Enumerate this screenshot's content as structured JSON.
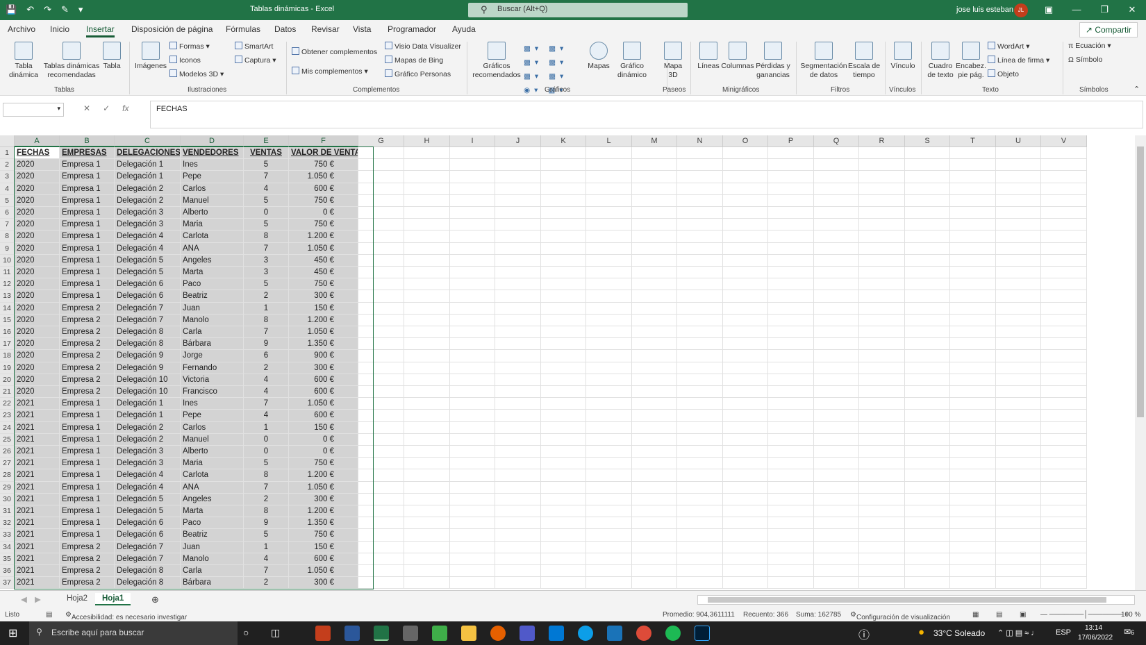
{
  "titlebar": {
    "title": "Tablas dinámicas  -  Excel",
    "search_placeholder": "Buscar (Alt+Q)",
    "user": "jose luis esteban",
    "avatar": "JL"
  },
  "tabs": [
    "Archivo",
    "Inicio",
    "Insertar",
    "Disposición de página",
    "Fórmulas",
    "Datos",
    "Revisar",
    "Vista",
    "Programador",
    "Ayuda"
  ],
  "active_tab": "Insertar",
  "share_label": "Compartir",
  "ribbon": {
    "tablas": {
      "b1": "Tabla dinámica",
      "b2": "Tablas dinámicas recomendadas",
      "b3": "Tabla",
      "label": "Tablas"
    },
    "ilustr": {
      "imagenes": "Imágenes",
      "formas": "Formas",
      "iconos": "Iconos",
      "modelos": "Modelos 3D",
      "smartart": "SmartArt",
      "captura": "Captura",
      "label": "Ilustraciones"
    },
    "compl": {
      "obtener": "Obtener complementos",
      "mis": "Mis complementos",
      "visio": "Visio Data Visualizer",
      "bing": "Mapas de Bing",
      "personas": "Gráfico Personas",
      "label": "Complementos"
    },
    "graf": {
      "recom": "Gráficos recomendados",
      "mapas": "Mapas",
      "dinamico": "Gráfico dinámico",
      "label": "Gráficos"
    },
    "paseos": {
      "mapa": "Mapa 3D",
      "label": "Paseos"
    },
    "mini": {
      "lineas": "Líneas",
      "columnas": "Columnas",
      "perdidas": "Pérdidas y ganancias",
      "label": "Minigráficos"
    },
    "filtros": {
      "seg": "Segmentación de datos",
      "escala": "Escala de tiempo",
      "label": "Filtros"
    },
    "vinc": {
      "vinculo": "Vínculo",
      "label": "Vínculos"
    },
    "texto": {
      "cuadro": "Cuadro de texto",
      "encab": "Encabez. pie pág.",
      "wordart": "WordArt",
      "firma": "Línea de firma",
      "objeto": "Objeto",
      "label": "Texto"
    },
    "simb": {
      "ecuacion": "Ecuación",
      "simbolo": "Símbolo",
      "label": "Símbolos"
    }
  },
  "formula_bar": {
    "value": "FECHAS",
    "fx": "fx"
  },
  "columns": [
    "A",
    "B",
    "C",
    "D",
    "E",
    "F",
    "G",
    "H",
    "I",
    "J",
    "K",
    "L",
    "M",
    "N",
    "O",
    "P",
    "Q",
    "R",
    "S",
    "T",
    "U",
    "V"
  ],
  "headers": [
    "FECHAS",
    "EMPRESAS",
    "DELEGACIONES",
    "VENDEDORES",
    "VENTAS",
    "VALOR DE VENTAS"
  ],
  "rows": [
    [
      "2020",
      "Empresa 1",
      "Delegación 1",
      "Ines",
      "5",
      "750 €"
    ],
    [
      "2020",
      "Empresa 1",
      "Delegación 1",
      "Pepe",
      "7",
      "1.050 €"
    ],
    [
      "2020",
      "Empresa 1",
      "Delegación 2",
      "Carlos",
      "4",
      "600 €"
    ],
    [
      "2020",
      "Empresa 1",
      "Delegación 2",
      "Manuel",
      "5",
      "750 €"
    ],
    [
      "2020",
      "Empresa 1",
      "Delegación 3",
      "Alberto",
      "0",
      "0 €"
    ],
    [
      "2020",
      "Empresa 1",
      "Delegación 3",
      "Maria",
      "5",
      "750 €"
    ],
    [
      "2020",
      "Empresa 1",
      "Delegación 4",
      "Carlota",
      "8",
      "1.200 €"
    ],
    [
      "2020",
      "Empresa 1",
      "Delegación 4",
      "ANA",
      "7",
      "1.050 €"
    ],
    [
      "2020",
      "Empresa 1",
      "Delegación 5",
      "Angeles",
      "3",
      "450 €"
    ],
    [
      "2020",
      "Empresa 1",
      "Delegación 5",
      "Marta",
      "3",
      "450 €"
    ],
    [
      "2020",
      "Empresa 1",
      "Delegación 6",
      "Paco",
      "5",
      "750 €"
    ],
    [
      "2020",
      "Empresa 1",
      "Delegación 6",
      "Beatriz",
      "2",
      "300 €"
    ],
    [
      "2020",
      "Empresa 2",
      "Delegación 7",
      "Juan",
      "1",
      "150 €"
    ],
    [
      "2020",
      "Empresa 2",
      "Delegación 7",
      "Manolo",
      "8",
      "1.200 €"
    ],
    [
      "2020",
      "Empresa 2",
      "Delegación 8",
      "Carla",
      "7",
      "1.050 €"
    ],
    [
      "2020",
      "Empresa 2",
      "Delegación 8",
      "Bárbara",
      "9",
      "1.350 €"
    ],
    [
      "2020",
      "Empresa 2",
      "Delegación 9",
      "Jorge",
      "6",
      "900 €"
    ],
    [
      "2020",
      "Empresa 2",
      "Delegación 9",
      "Fernando",
      "2",
      "300 €"
    ],
    [
      "2020",
      "Empresa 2",
      "Delegación 10",
      "Victoria",
      "4",
      "600 €"
    ],
    [
      "2020",
      "Empresa 2",
      "Delegación 10",
      "Francisco",
      "4",
      "600 €"
    ],
    [
      "2021",
      "Empresa 1",
      "Delegación 1",
      "Ines",
      "7",
      "1.050 €"
    ],
    [
      "2021",
      "Empresa 1",
      "Delegación 1",
      "Pepe",
      "4",
      "600 €"
    ],
    [
      "2021",
      "Empresa 1",
      "Delegación 2",
      "Carlos",
      "1",
      "150 €"
    ],
    [
      "2021",
      "Empresa 1",
      "Delegación 2",
      "Manuel",
      "0",
      "0 €"
    ],
    [
      "2021",
      "Empresa 1",
      "Delegación 3",
      "Alberto",
      "0",
      "0 €"
    ],
    [
      "2021",
      "Empresa 1",
      "Delegación 3",
      "Maria",
      "5",
      "750 €"
    ],
    [
      "2021",
      "Empresa 1",
      "Delegación 4",
      "Carlota",
      "8",
      "1.200 €"
    ],
    [
      "2021",
      "Empresa 1",
      "Delegación 4",
      "ANA",
      "7",
      "1.050 €"
    ],
    [
      "2021",
      "Empresa 1",
      "Delegación 5",
      "Angeles",
      "2",
      "300 €"
    ],
    [
      "2021",
      "Empresa 1",
      "Delegación 5",
      "Marta",
      "8",
      "1.200 €"
    ],
    [
      "2021",
      "Empresa 1",
      "Delegación 6",
      "Paco",
      "9",
      "1.350 €"
    ],
    [
      "2021",
      "Empresa 1",
      "Delegación 6",
      "Beatriz",
      "5",
      "750 €"
    ],
    [
      "2021",
      "Empresa 2",
      "Delegación 7",
      "Juan",
      "1",
      "150 €"
    ],
    [
      "2021",
      "Empresa 2",
      "Delegación 7",
      "Manolo",
      "4",
      "600 €"
    ],
    [
      "2021",
      "Empresa 2",
      "Delegación 8",
      "Carla",
      "7",
      "1.050 €"
    ],
    [
      "2021",
      "Empresa 2",
      "Delegación 8",
      "Bárbara",
      "2",
      "300 €"
    ]
  ],
  "sheets": [
    "Hoja2",
    "Hoja1"
  ],
  "active_sheet": "Hoja1",
  "status": {
    "ready": "Listo",
    "access": "Accesibilidad: es necesario investigar",
    "avg": "Promedio: 904,3611111",
    "count": "Recuento: 366",
    "sum": "Suma: 162785",
    "config": "Configuración de visualización",
    "zoom": "100 %"
  },
  "taskbar": {
    "search": "Escribe aquí para buscar",
    "weather": "33°C  Soleado",
    "lang": "ESP",
    "time": "13:14",
    "date": "17/06/2022",
    "notif": "6"
  },
  "colors": {
    "excel_green": "#217346"
  }
}
